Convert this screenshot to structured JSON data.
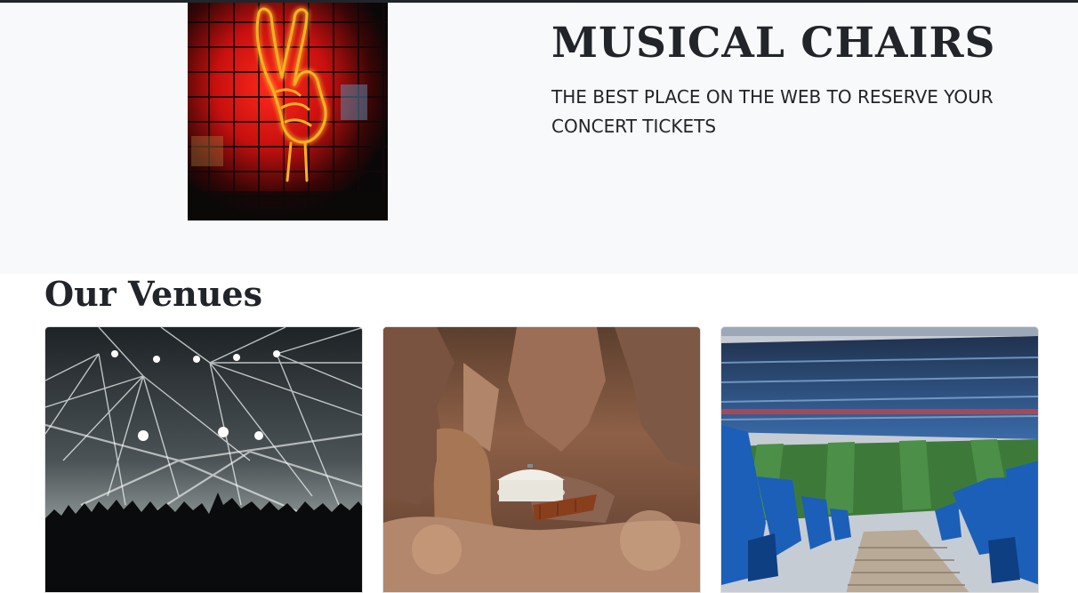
{
  "hero": {
    "title": "MUSICAL CHAIRS",
    "tagline": "THE BEST PLACE ON THE WEB TO RESERVE YOUR CONCERT TICKETS",
    "image_icon": "neon-peace-hand-image"
  },
  "venues": {
    "heading": "Our Venues",
    "cards": [
      {
        "image_icon": "concert-lights-crowd-image"
      },
      {
        "image_icon": "canyon-yurt-image"
      },
      {
        "image_icon": "stadium-seats-field-image"
      }
    ]
  },
  "colors": {
    "hero_background": "#f8f9fa",
    "text": "#212529",
    "neon_red": "#e0141c",
    "neon_yellow": "#ffcf2e"
  }
}
